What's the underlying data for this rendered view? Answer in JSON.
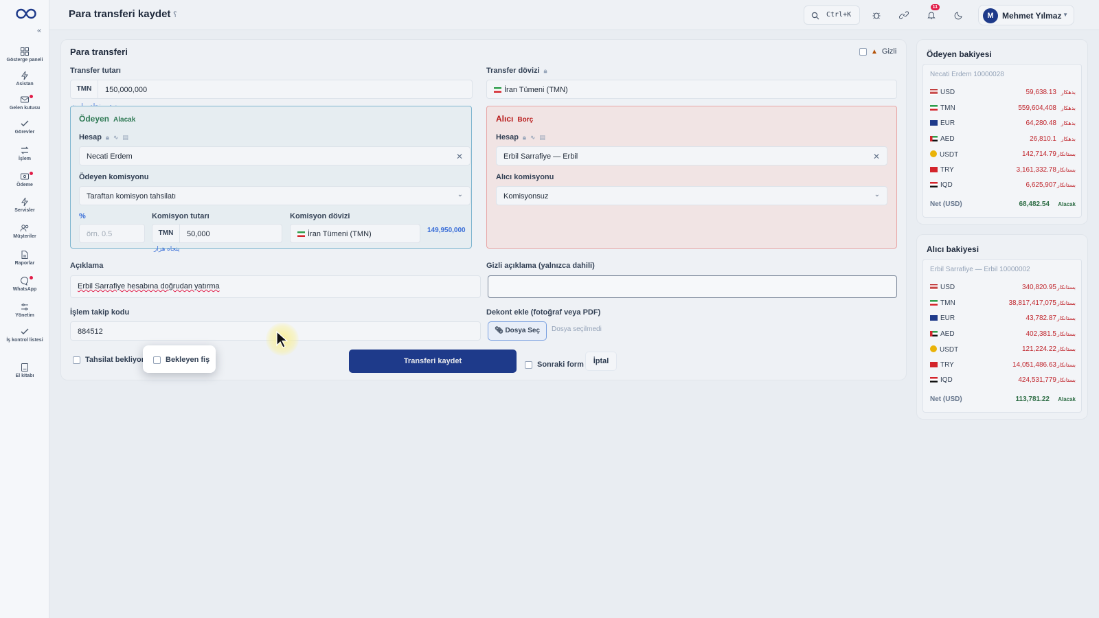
{
  "header": {
    "title": "Para transferi kaydet",
    "help_glyph": "؟",
    "search_shortcut": "Ctrl+K",
    "notification_count": "11",
    "user_initial": "M",
    "user_name": "Mehmet Yılmaz"
  },
  "sidebar": {
    "items": [
      {
        "label": "Gösterge paneli",
        "icon": "dashboard-icon"
      },
      {
        "label": "Asistan",
        "icon": "lightning-icon"
      },
      {
        "label": "Gelen kutusu",
        "icon": "inbox-icon"
      },
      {
        "label": "Görevler",
        "icon": "check-icon"
      },
      {
        "label": "İşlem",
        "icon": "transfer-icon"
      },
      {
        "label": "Ödeme",
        "icon": "payment-icon"
      },
      {
        "label": "Servisler",
        "icon": "lightning-icon"
      },
      {
        "label": "Müşteriler",
        "icon": "users-icon"
      },
      {
        "label": "Raporlar",
        "icon": "report-icon"
      },
      {
        "label": "WhatsApp",
        "icon": "chat-icon"
      },
      {
        "label": "Yönetim",
        "icon": "sliders-icon"
      },
      {
        "label": "İş kontrol listesi",
        "icon": "checklist-icon"
      },
      {
        "label": "El kitabı",
        "icon": "book-icon"
      }
    ]
  },
  "form": {
    "title": "Para transferi",
    "hidden_label": "Gizli",
    "amount_label": "Transfer tutarı",
    "amount_currency": "TMN",
    "amount_value": "150,000,000",
    "amount_words": "صد و پنجاه میلیون",
    "transfer_currency_label": "Transfer dövizi",
    "transfer_currency_value": "İran Tümeni (TMN)",
    "payer": {
      "title": "Ödeyen",
      "tag": "Alacak",
      "account_label": "Hesap",
      "account_value": "Necati Erdem",
      "commission_label": "Ödeyen komisyonu",
      "commission_value": "Taraftan komisyon tahsilatı",
      "percent_label": "%",
      "percent_placeholder": "örn. 0.5",
      "commission_amount_label": "Komisyon tutarı",
      "commission_amount_currency": "TMN",
      "commission_amount_value": "50,000",
      "commission_amount_words": "پنجاه هزار",
      "commission_currency_label": "Komisyon dövizi",
      "commission_currency_value": "İran Tümeni (TMN)",
      "net_amount": "149,950,000"
    },
    "receiver": {
      "title": "Alıcı",
      "tag": "Borç",
      "account_label": "Hesap",
      "account_value": "Erbil Sarrafiye — Erbil",
      "commission_label": "Alıcı komisyonu",
      "commission_value": "Komisyonsuz"
    },
    "description_label": "Açıklama",
    "description_value": "Erbil Sarrafiye hesabına doğrudan yatırma",
    "hidden_desc_label": "Gizli açıklama (yalnızca dahili)",
    "hidden_desc_value": "",
    "tracking_label": "İşlem takip kodu",
    "tracking_value": "884512",
    "receipt_label": "Dekont ekle (fotoğraf veya PDF)",
    "file_button": "Dosya Seç",
    "no_file": "Dosya seçilmedi",
    "awaiting_collection": "Tahsilat bekliyor",
    "pending_receipt": "Bekleyen fiş",
    "save_button": "Transferi kaydet",
    "next_form": "Sonraki form",
    "cancel_button": "İptal"
  },
  "payer_balance": {
    "title": "Ödeyen bakiyesi",
    "account": "Necati Erdem 10000028",
    "rows": [
      {
        "currency": "USD",
        "amount": "59,638.13",
        "side": "بدهکار"
      },
      {
        "currency": "TMN",
        "amount": "559,604,408",
        "side": "بدهکار"
      },
      {
        "currency": "EUR",
        "amount": "64,280.48",
        "side": "بدهکار"
      },
      {
        "currency": "AED",
        "amount": "26,810.1",
        "side": "بدهکار"
      },
      {
        "currency": "USDT",
        "amount": "142,714.79",
        "side": "بستانکار"
      },
      {
        "currency": "TRY",
        "amount": "3,161,332.78",
        "side": "بستانکار"
      },
      {
        "currency": "IQD",
        "amount": "6,625,907",
        "side": "بستانکار"
      }
    ],
    "net_label": "Net (USD)",
    "net_value": "68,482.54",
    "net_tag": "Alacak"
  },
  "receiver_balance": {
    "title": "Alıcı bakiyesi",
    "account": "Erbil Sarrafiye — Erbil 10000002",
    "rows": [
      {
        "currency": "USD",
        "amount": "340,820.95",
        "side": "بستانکار"
      },
      {
        "currency": "TMN",
        "amount": "38,817,417,075",
        "side": "بستانکار"
      },
      {
        "currency": "EUR",
        "amount": "43,782.87",
        "side": "بستانکار"
      },
      {
        "currency": "AED",
        "amount": "402,381.5",
        "side": "بستانکار"
      },
      {
        "currency": "USDT",
        "amount": "121,224.22",
        "side": "بستانکار"
      },
      {
        "currency": "TRY",
        "amount": "14,051,486.63",
        "side": "بستانکار"
      },
      {
        "currency": "IQD",
        "amount": "424,531,779",
        "side": "بستانکار"
      }
    ],
    "net_label": "Net (USD)",
    "net_value": "113,781.22",
    "net_tag": "Alacak"
  },
  "colors": {
    "primary": "#1e3a8a",
    "payer_border": "#7eb5cf",
    "receiver_border": "#e8a5a5",
    "debit_red": "#c0262d",
    "credit_green": "#2f6e46"
  }
}
